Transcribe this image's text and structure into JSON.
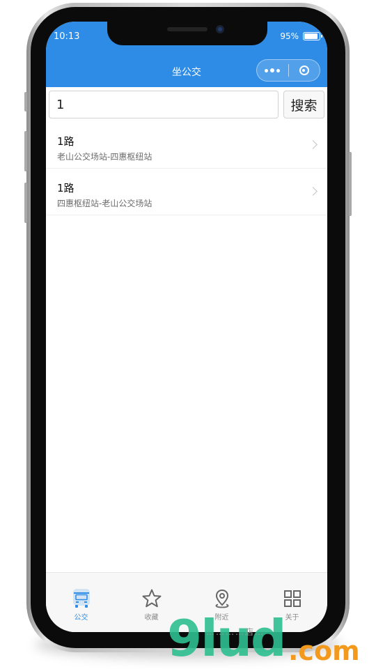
{
  "status_bar": {
    "time": "10:13",
    "battery": "95%"
  },
  "nav_bar": {
    "title": "坐公交"
  },
  "search": {
    "value": "1",
    "button_label": "搜索"
  },
  "routes": [
    {
      "name": "1路",
      "stops": "老山公交场站-四惠枢纽站"
    },
    {
      "name": "1路",
      "stops": "四惠枢纽站-老山公交场站"
    }
  ],
  "tabbar": {
    "tabs": [
      {
        "label": "公交",
        "icon": "bus-icon",
        "active": true
      },
      {
        "label": "收藏",
        "icon": "star-icon",
        "active": false
      },
      {
        "label": "附近",
        "icon": "location-pin-icon",
        "active": false
      },
      {
        "label": "关于",
        "icon": "grid-icon",
        "active": false
      }
    ]
  },
  "watermark": {
    "brand": "9lud",
    "tld": ".com",
    "tagline": "…………店…"
  },
  "colors": {
    "accent": "#2e8ce6",
    "inactive": "#888888"
  }
}
